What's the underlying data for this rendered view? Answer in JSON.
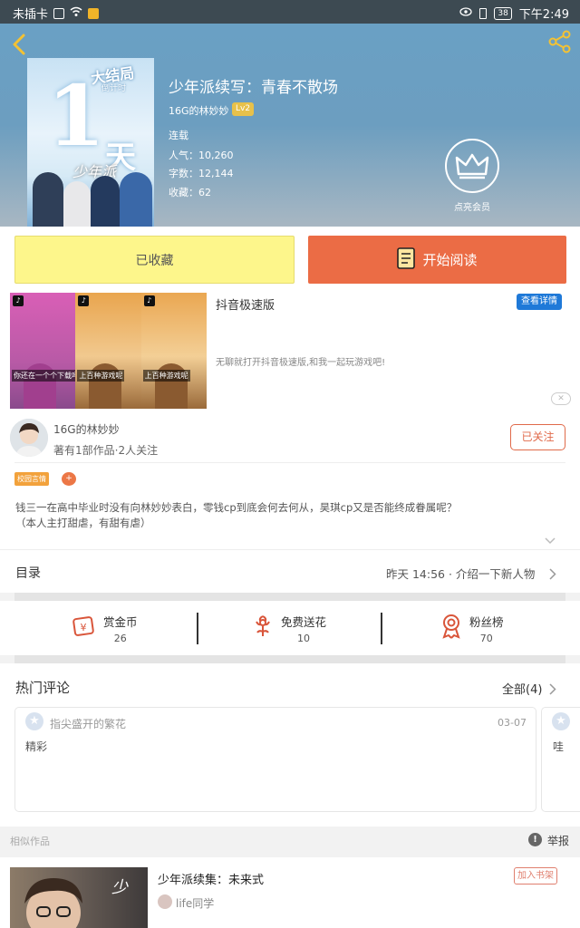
{
  "status_bar": {
    "carrier": "未插卡",
    "battery": "38",
    "time": "下午2:49"
  },
  "book": {
    "title": "少年派续写：青春不散场",
    "author": "16G的林妙妙",
    "level": "Lv2",
    "status": "连载",
    "popularity": "人气：10,260",
    "word_count": "字数：12,144",
    "favorites": "收藏：62",
    "vip_label": "点亮会员",
    "cover": {
      "headline": "大结局",
      "countdown_sub": "倒计时",
      "big_number": "1",
      "big_char": "天",
      "logo_text": "少年派"
    }
  },
  "actions": {
    "collected_label": "已收藏",
    "read_label": "开始阅读"
  },
  "ad": {
    "title": "抖音极速版",
    "detail_button": "查看详情",
    "description": "无聊就打开抖音极速版,和我一起玩游戏吧!",
    "close_label": "✕",
    "panel_captions": [
      "你还在一个个下载吗",
      "上百种游戏呢",
      "上百种游戏呢"
    ]
  },
  "author_card": {
    "name": "16G的林妙妙",
    "stats": "著有1部作品·2人关注",
    "follow_label": "已关注"
  },
  "tags": [
    "校园言情",
    "+"
  ],
  "synopsis_lines": [
    "钱三一在高中毕业时没有向林妙妙表白，零钱cp到底会何去何从，昊琪cp又是否能终成眷属呢？",
    "（本人主打甜虐，有甜有虐）"
  ],
  "toc": {
    "label": "目录",
    "latest": "昨天 14:56 · 介绍一下新人物"
  },
  "stats": [
    {
      "label": "赏金币",
      "value": "26",
      "icon": "coin-icon"
    },
    {
      "label": "免费送花",
      "value": "10",
      "icon": "flower-icon"
    },
    {
      "label": "粉丝榜",
      "value": "70",
      "icon": "medal-icon"
    }
  ],
  "comments": {
    "title": "热门评论",
    "all_label": "全部(4)",
    "items": [
      {
        "user": "指尖盛开的繁花",
        "date": "03-07",
        "text": "精彩"
      },
      {
        "text": "哇"
      }
    ]
  },
  "similar": {
    "label": "相似作品",
    "report_label": "举报",
    "item": {
      "title": "少年派续集：未来式",
      "author": "life同学",
      "add_label": "加入书架"
    }
  },
  "colors": {
    "accent_orange": "#eb6c45",
    "collected_yellow": "#fdf68b",
    "detail_blue": "#1f79d8",
    "header_blue": "#6aa0c4"
  }
}
